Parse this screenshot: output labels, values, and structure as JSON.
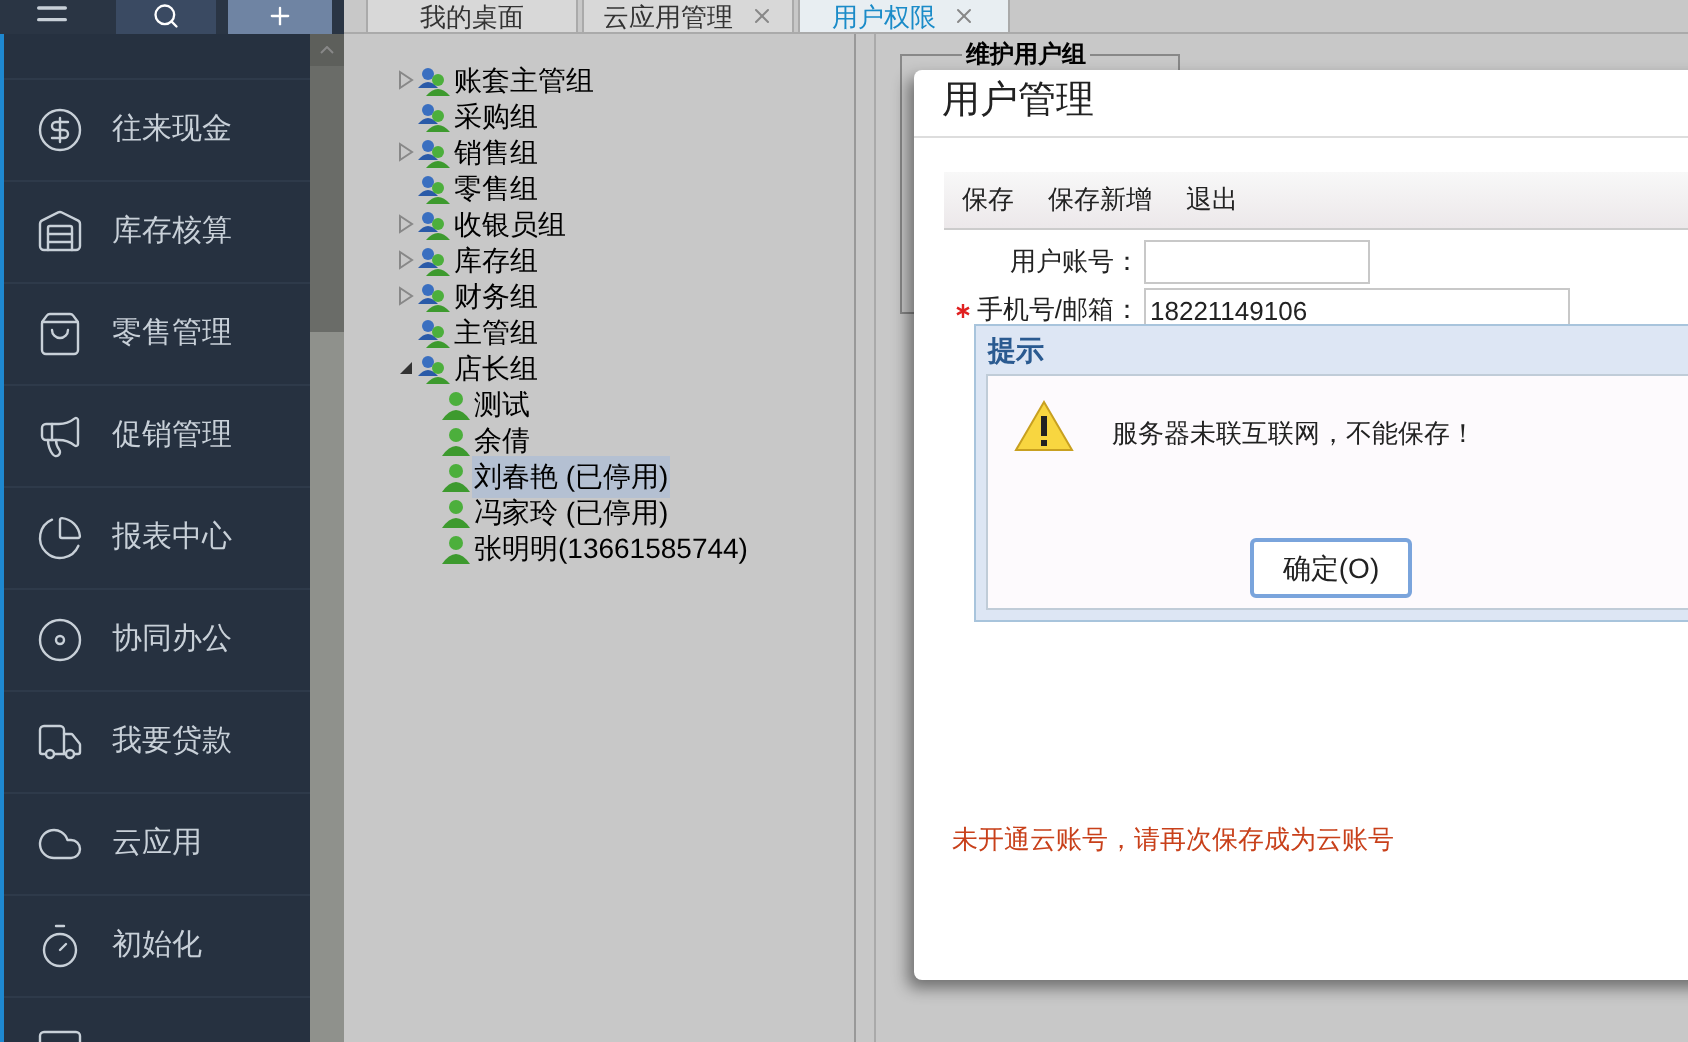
{
  "sidebar": {
    "items": [
      {
        "label": "往来现金"
      },
      {
        "label": "库存核算"
      },
      {
        "label": "零售管理"
      },
      {
        "label": "促销管理"
      },
      {
        "label": "报表中心"
      },
      {
        "label": "协同办公"
      },
      {
        "label": "我要贷款"
      },
      {
        "label": "云应用"
      },
      {
        "label": "初始化"
      }
    ]
  },
  "tabs": [
    {
      "label": "我的桌面",
      "selected": false,
      "closable": false
    },
    {
      "label": "云应用管理",
      "selected": false,
      "closable": true
    },
    {
      "label": "用户权限",
      "selected": true,
      "closable": true
    }
  ],
  "tree": [
    {
      "label": "账套主管组",
      "kind": "group",
      "expandable": true,
      "expanded": false
    },
    {
      "label": "采购组",
      "kind": "group",
      "expandable": false
    },
    {
      "label": "销售组",
      "kind": "group",
      "expandable": true,
      "expanded": false
    },
    {
      "label": "零售组",
      "kind": "group",
      "expandable": false
    },
    {
      "label": "收银员组",
      "kind": "group",
      "expandable": true,
      "expanded": false
    },
    {
      "label": "库存组",
      "kind": "group",
      "expandable": true,
      "expanded": false
    },
    {
      "label": "财务组",
      "kind": "group",
      "expandable": true,
      "expanded": false
    },
    {
      "label": "主管组",
      "kind": "group",
      "expandable": false
    },
    {
      "label": "店长组",
      "kind": "group",
      "expandable": true,
      "expanded": true,
      "children": [
        {
          "label": "测试",
          "kind": "user",
          "selected": false
        },
        {
          "label": "余倩",
          "kind": "user",
          "selected": false
        },
        {
          "label": "刘春艳 (已停用)",
          "kind": "user",
          "selected": true
        },
        {
          "label": "冯家玲 (已停用)",
          "kind": "user",
          "selected": false
        },
        {
          "label": "张明明(13661585744)",
          "kind": "user",
          "selected": false
        }
      ]
    }
  ],
  "fieldset": {
    "legend": "维护用户组"
  },
  "dialog": {
    "title": "用户管理",
    "toolbar": [
      "保存",
      "保存新增",
      "退出"
    ],
    "fields": [
      {
        "label": "用户账号：",
        "required": false
      },
      {
        "label": "手机号/邮箱：",
        "required": true,
        "value": "18221149106"
      }
    ],
    "note": "未开通云账号，请再次保存成为云账号"
  },
  "alert": {
    "title": "提示",
    "message": "服务器未联互联网，不能保存！",
    "button": "确定(O)"
  }
}
